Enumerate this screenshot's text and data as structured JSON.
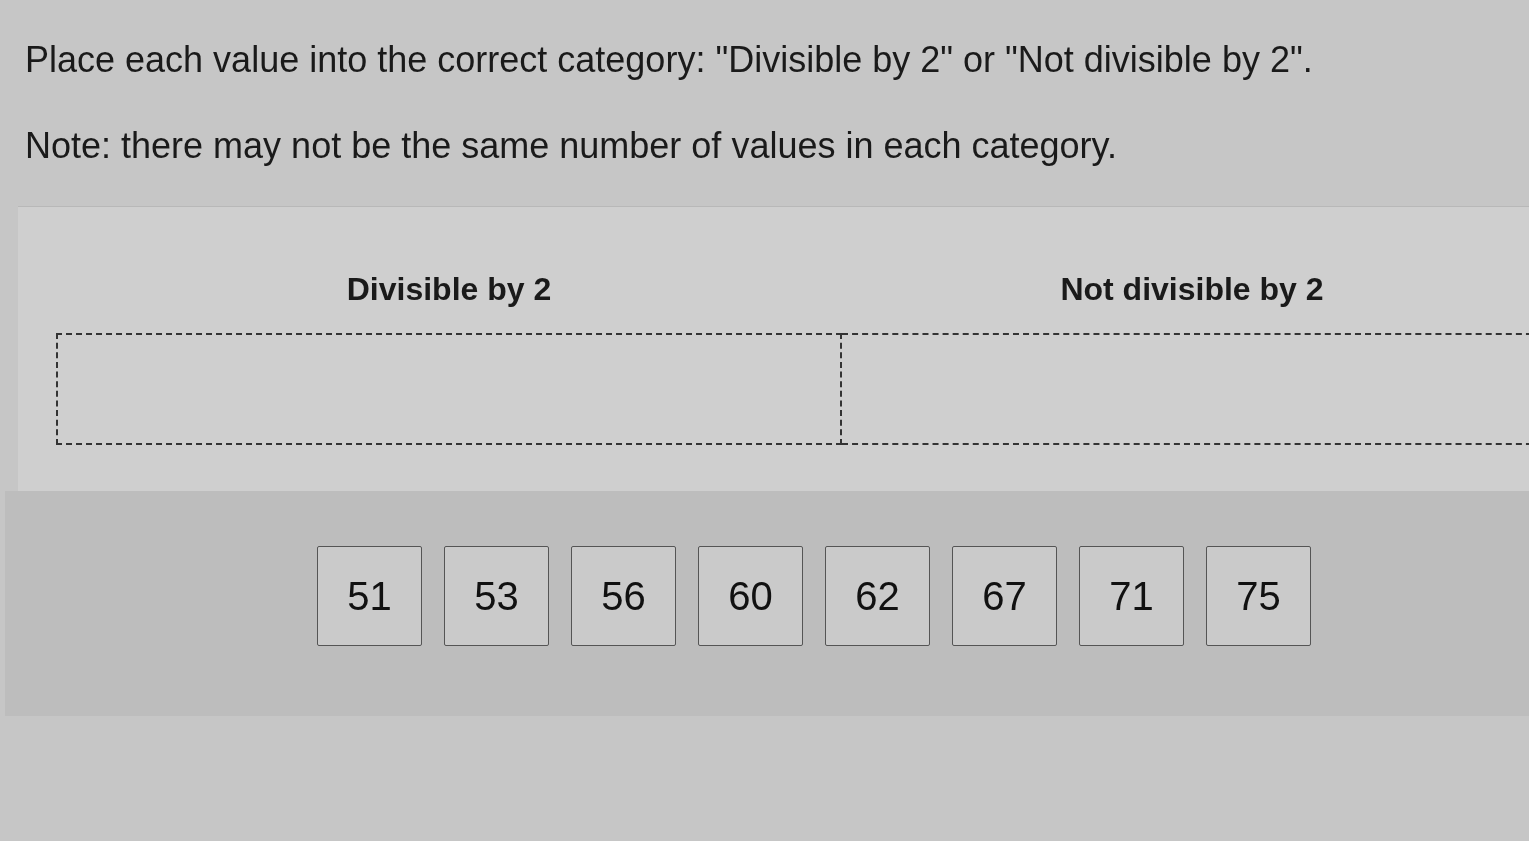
{
  "instructions": [
    "Place each value into the correct category: \"Divisible by 2\" or \"Not divisible by 2\".",
    "Note: there may not be the same number of values in each category."
  ],
  "categories": [
    {
      "label": "Divisible by 2"
    },
    {
      "label": "Not divisible by 2"
    }
  ],
  "values": [
    "51",
    "53",
    "56",
    "60",
    "62",
    "67",
    "71",
    "75"
  ]
}
